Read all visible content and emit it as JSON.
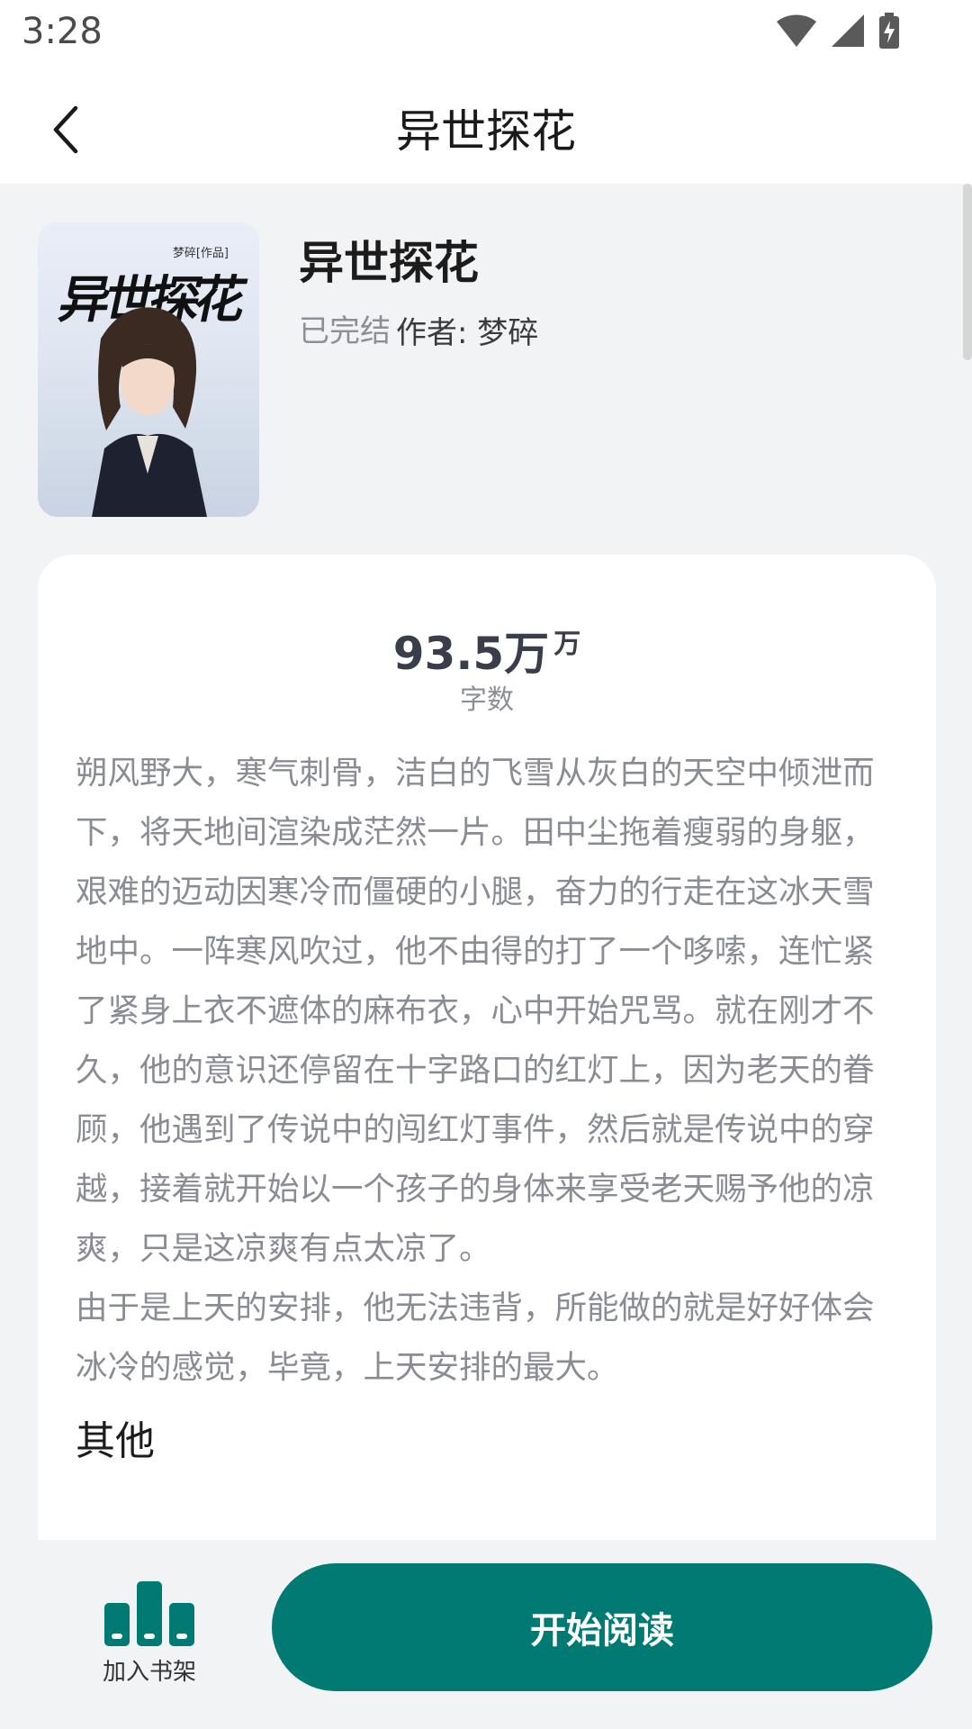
{
  "status_bar": {
    "time": "3:28"
  },
  "app_bar": {
    "title": "异世探花"
  },
  "book": {
    "cover_tag": "梦碎[作品]",
    "cover_script": "异世探花",
    "title": "异世探花",
    "status": "已完结",
    "author": "作者: 梦碎"
  },
  "stats": {
    "word_count": "93.5万",
    "word_count_unit": "万",
    "word_count_label": "字数"
  },
  "synopsis": {
    "paragraphs": [
      "朔风野大，寒气刺骨，洁白的飞雪从灰白的天空中倾泄而下，将天地间渲染成茫然一片。田中尘拖着瘦弱的身躯，艰难的迈动因寒冷而僵硬的小腿，奋力的行走在这冰天雪地中。一阵寒风吹过，他不由得的打了一个哆嗦，连忙紧了紧身上衣不遮体的麻布衣，心中开始咒骂。就在刚才不久，他的意识还停留在十字路口的红灯上，因为老天的眷顾，他遇到了传说中的闯红灯事件，然后就是传说中的穿越，接着就开始以一个孩子的身体来享受老天赐予他的凉爽，只是这凉爽有点太凉了。",
      "由于是上天的安排，他无法违背，所能做的就是好好体会冰冷的感觉，毕竟，上天安排的最大。"
    ]
  },
  "other_section": {
    "title": "其他"
  },
  "bottom_bar": {
    "shelf_label": "加入书架",
    "read_label": "开始阅读",
    "accent_color": "#007a73"
  }
}
